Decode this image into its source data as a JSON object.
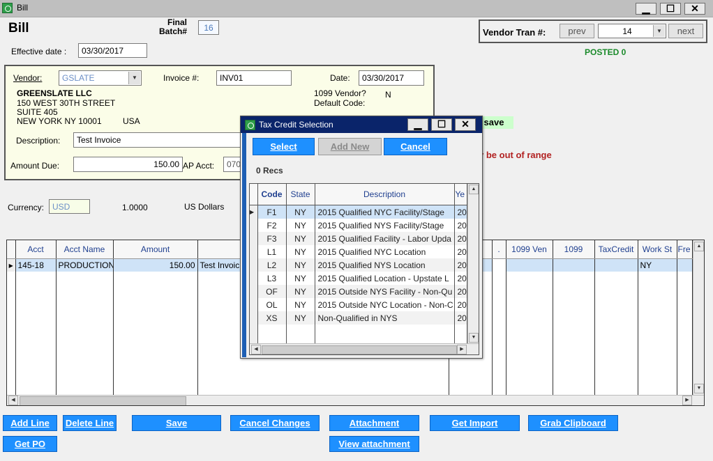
{
  "window": {
    "title": "Bill",
    "minimize": "▁",
    "maximize": "☐",
    "close": "✕"
  },
  "header": {
    "page_title": "Bill",
    "final_batch_label": "Final\nBatch#",
    "final_batch_value": "16",
    "effective_date_label": "Effective date :",
    "effective_date_value": "03/30/2017",
    "vendor_tran_label": "Vendor Tran #:",
    "prev_label": "prev",
    "vendor_tran_value": "14",
    "next_label": "next",
    "posted_status": "POSTED 0"
  },
  "vendor": {
    "vendor_label": "Vendor:",
    "vendor_value": "GSLATE",
    "invoice_label": "Invoice #:",
    "invoice_value": "INV01",
    "date_label": "Date:",
    "date_value": "03/30/2017",
    "name": "GREENSLATE LLC",
    "address1": "150 WEST 30TH STREET",
    "address2": "SUITE 405",
    "city_state_zip": "NEW YORK NY  10001",
    "country": "USA",
    "vendor_1099_label": "1099 Vendor?",
    "vendor_1099_value": "N",
    "default_code_label": "Default Code:",
    "description_label": "Description:",
    "description_value": "Test Invoice",
    "amount_due_label": "Amount Due:",
    "amount_due_value": "150.00",
    "ap_acct_label": "AP Acct:",
    "ap_acct_value": "070",
    "save_hint": "o save",
    "range_warning": "y be out of range"
  },
  "currency": {
    "label": "Currency:",
    "value": "USD",
    "rate": "1.0000",
    "name": "US Dollars"
  },
  "grid": {
    "columns": [
      "Acct",
      "Acct Name",
      "Amount",
      "",
      ".",
      "1099 Ven",
      "1099",
      "TaxCredit",
      "Work St",
      "Fre"
    ],
    "rows": [
      {
        "acct": "145-18",
        "acct_name": "PRODUCTION",
        "amount": "150.00",
        "desc": "Test Invoic",
        "work_state": "NY"
      }
    ]
  },
  "buttons": {
    "add_line": "Add Line",
    "delete_line": "Delete Line",
    "save": "Save",
    "cancel_changes": "Cancel Changes",
    "attachment": "Attachment",
    "get_import": "Get Import",
    "grab_clipboard": "Grab Clipboard",
    "get_po": "Get PO",
    "view_attachment": "View attachment"
  },
  "dialog": {
    "title": "Tax Credit Selection",
    "select_label": "Select",
    "add_new_label": "Add New",
    "cancel_label": "Cancel",
    "recs": "0 Recs",
    "columns": [
      "Code",
      "State",
      "Description",
      "Ye"
    ],
    "rows": [
      {
        "code": "F1",
        "state": "NY",
        "description": "2015 Qualified NYC Facility/Stage",
        "year": "20"
      },
      {
        "code": "F2",
        "state": "NY",
        "description": "2015 Qualified NYS Facility/Stage",
        "year": "20"
      },
      {
        "code": "F3",
        "state": "NY",
        "description": "2015 Qualified Facility - Labor Upda",
        "year": "20"
      },
      {
        "code": "L1",
        "state": "NY",
        "description": "2015 Qualified NYC Location",
        "year": "20"
      },
      {
        "code": "L2",
        "state": "NY",
        "description": "2015 Qualified NYS Location",
        "year": "20"
      },
      {
        "code": "L3",
        "state": "NY",
        "description": "2015 Qualified Location - Upstate L",
        "year": "20"
      },
      {
        "code": "OF",
        "state": "NY",
        "description": "2015 Outside NYS Facility - Non-Qu",
        "year": "20"
      },
      {
        "code": "OL",
        "state": "NY",
        "description": "2015 Outside NYC Location - Non-C",
        "year": "20"
      },
      {
        "code": "XS",
        "state": "NY",
        "description": "Non-Qualified in NYS",
        "year": "20"
      }
    ]
  },
  "colors": {
    "button_blue": "#1e90ff",
    "posted_green": "#1a8a2a",
    "warning_red": "#b22222",
    "vendor_panel": "#fbfde8",
    "dialog_frame": "#0a246a"
  }
}
